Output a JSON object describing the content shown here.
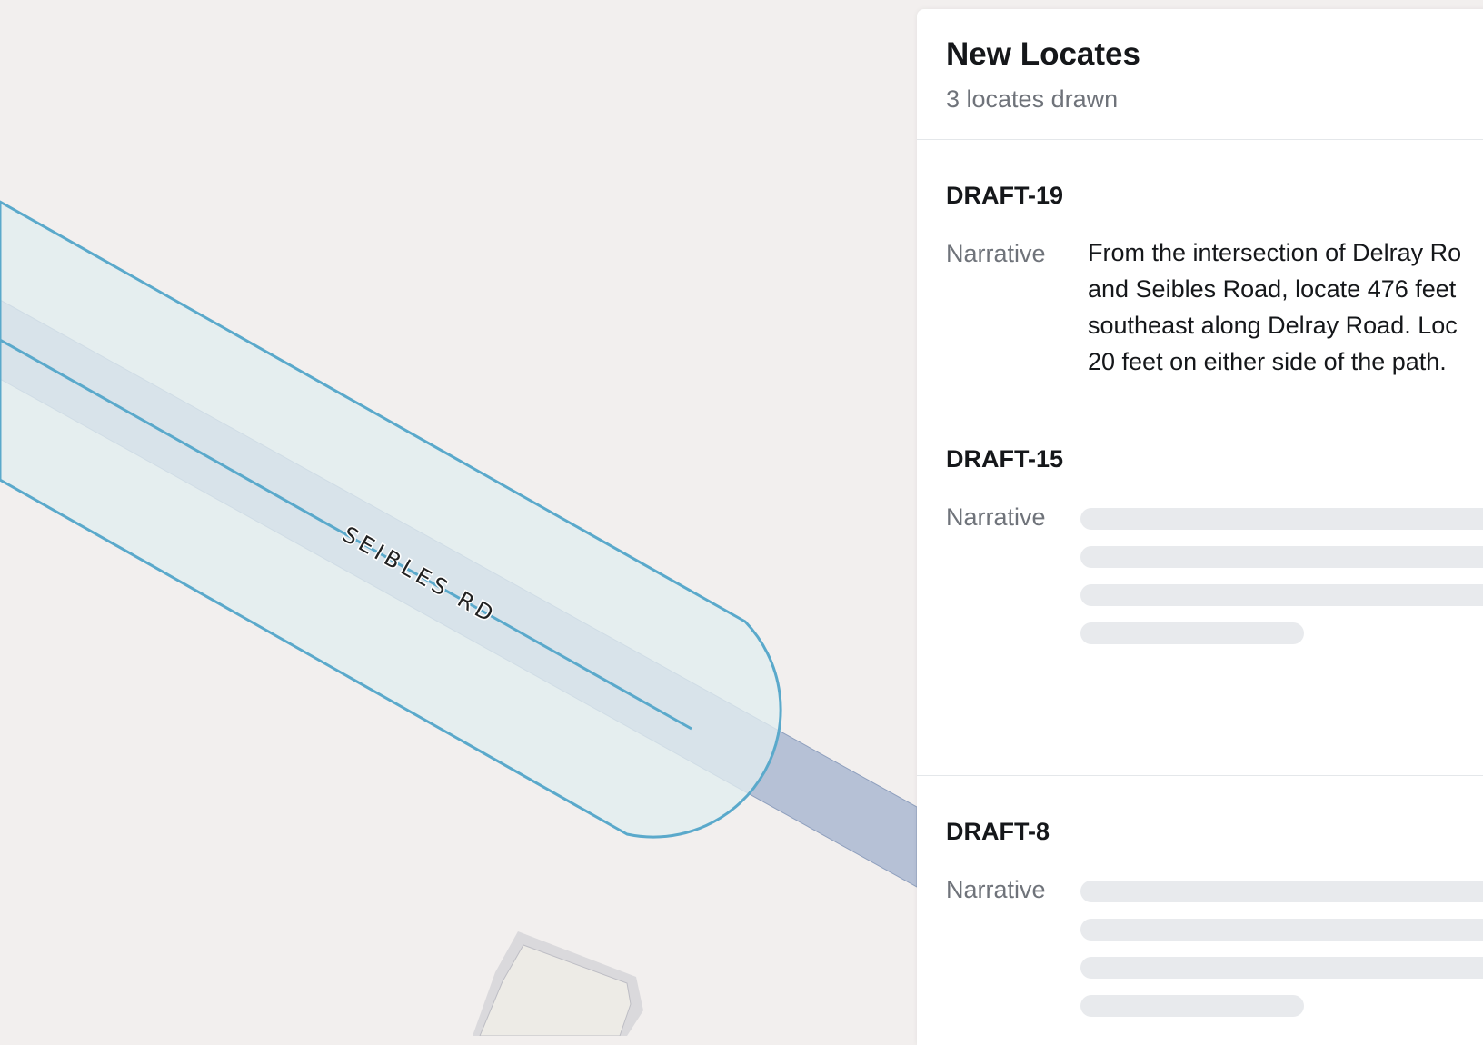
{
  "map": {
    "road_label": "SEIBLES RD",
    "colors": {
      "background": "#f2efee",
      "buffer_fill": "#e1e9ea",
      "road_fill": "#b6c1d6",
      "outline": "#5aa9cb"
    }
  },
  "panel": {
    "title": "New Locates",
    "subtitle": "3 locates drawn",
    "locates": [
      {
        "id": "DRAFT-19",
        "label": "Narrative",
        "narrative_lines": [
          "From the intersection of Delray Ro",
          "and Seibles Road, locate 476 feet",
          "southeast along Delray Road. Loc",
          "20 feet on either side of the path."
        ],
        "loading": false
      },
      {
        "id": "DRAFT-15",
        "label": "Narrative",
        "loading": true
      },
      {
        "id": "DRAFT-8",
        "label": "Narrative",
        "loading": true
      }
    ]
  }
}
